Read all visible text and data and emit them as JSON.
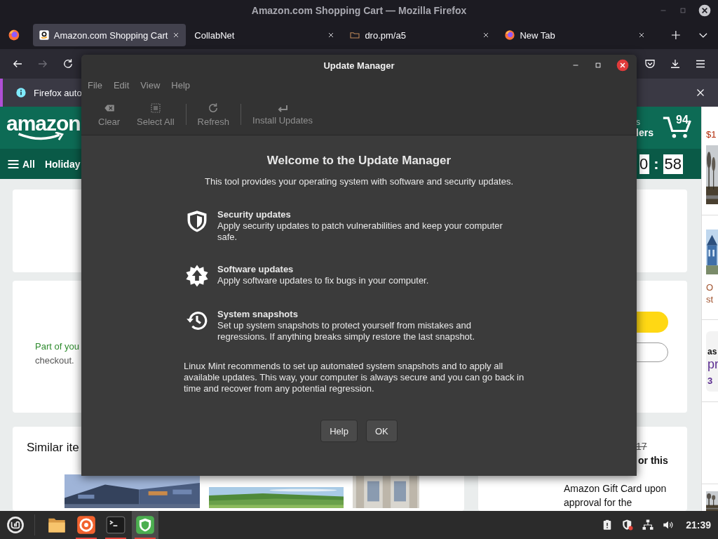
{
  "window": {
    "title": "Amazon.com Shopping Cart — Mozilla Firefox"
  },
  "tabs": [
    {
      "label": "Amazon.com Shopping Cart",
      "selected": true,
      "kind": "amazon"
    },
    {
      "label": "CollabNet",
      "selected": false,
      "kind": "blank"
    },
    {
      "label": "dro.pm/a5",
      "selected": false,
      "kind": "folder"
    },
    {
      "label": "New Tab",
      "selected": false,
      "kind": "firefox"
    }
  ],
  "notification": {
    "text": "Firefox auto"
  },
  "amazon_header": {
    "logo": "amazon",
    "account_line_1": "s",
    "account_line_2": "lers",
    "cart_count": "94",
    "nav_all": "All",
    "nav_item": "Holiday",
    "timer_1": "0",
    "timer_separator": ":",
    "timer_2": "58"
  },
  "cart_page": {
    "notice_line_1": "Part of you",
    "notice_line_2": "checkout.",
    "similar_heading": "Similar ite",
    "offer_old_price": "17",
    "offer_line_2": "or this",
    "offer_line_4": "Amazon Gift Card upon",
    "offer_line_5": "approval for the"
  },
  "side_column": {
    "price": "$1",
    "text_1": "O",
    "text_2": "st",
    "text_3": "as",
    "text_4": "pr",
    "text_5": "3"
  },
  "dialog": {
    "title": "Update Manager",
    "menu": [
      "File",
      "Edit",
      "View",
      "Help"
    ],
    "toolbar": [
      {
        "label": "Clear",
        "kind": "clear",
        "separator_before": false
      },
      {
        "label": "Select All",
        "kind": "select_all",
        "separator_before": false
      },
      {
        "label": "Refresh",
        "kind": "refresh",
        "separator_before": true
      },
      {
        "label": "Install Updates",
        "kind": "install",
        "separator_before": true
      }
    ],
    "heading": "Welcome to the Update Manager",
    "intro": "This tool provides your operating system with software and security updates.",
    "features": [
      {
        "kind": "security",
        "title": "Security updates",
        "text": "Apply security updates to patch vulnerabilities and keep your computer safe."
      },
      {
        "kind": "software",
        "title": "Software updates",
        "text": "Apply software updates to fix bugs in your computer."
      },
      {
        "kind": "snapshots",
        "title": "System snapshots",
        "text": "Set up system snapshots to protect yourself from mistakes and regressions. If anything breaks simply restore the last snapshot."
      }
    ],
    "note": "Linux Mint recommends to set up automated system snapshots and to apply all available updates. This way, your computer is always secure and you can go back in time and recover from any potential regression.",
    "buttons": [
      "Help",
      "OK"
    ]
  },
  "taskbar": {
    "apps": [
      {
        "kind": "files",
        "active": false,
        "running": false
      },
      {
        "kind": "firefox",
        "active": false,
        "running": true
      },
      {
        "kind": "terminal",
        "active": false,
        "running": true
      },
      {
        "kind": "update",
        "active": true,
        "running": true
      }
    ],
    "clock": "21:39"
  }
}
